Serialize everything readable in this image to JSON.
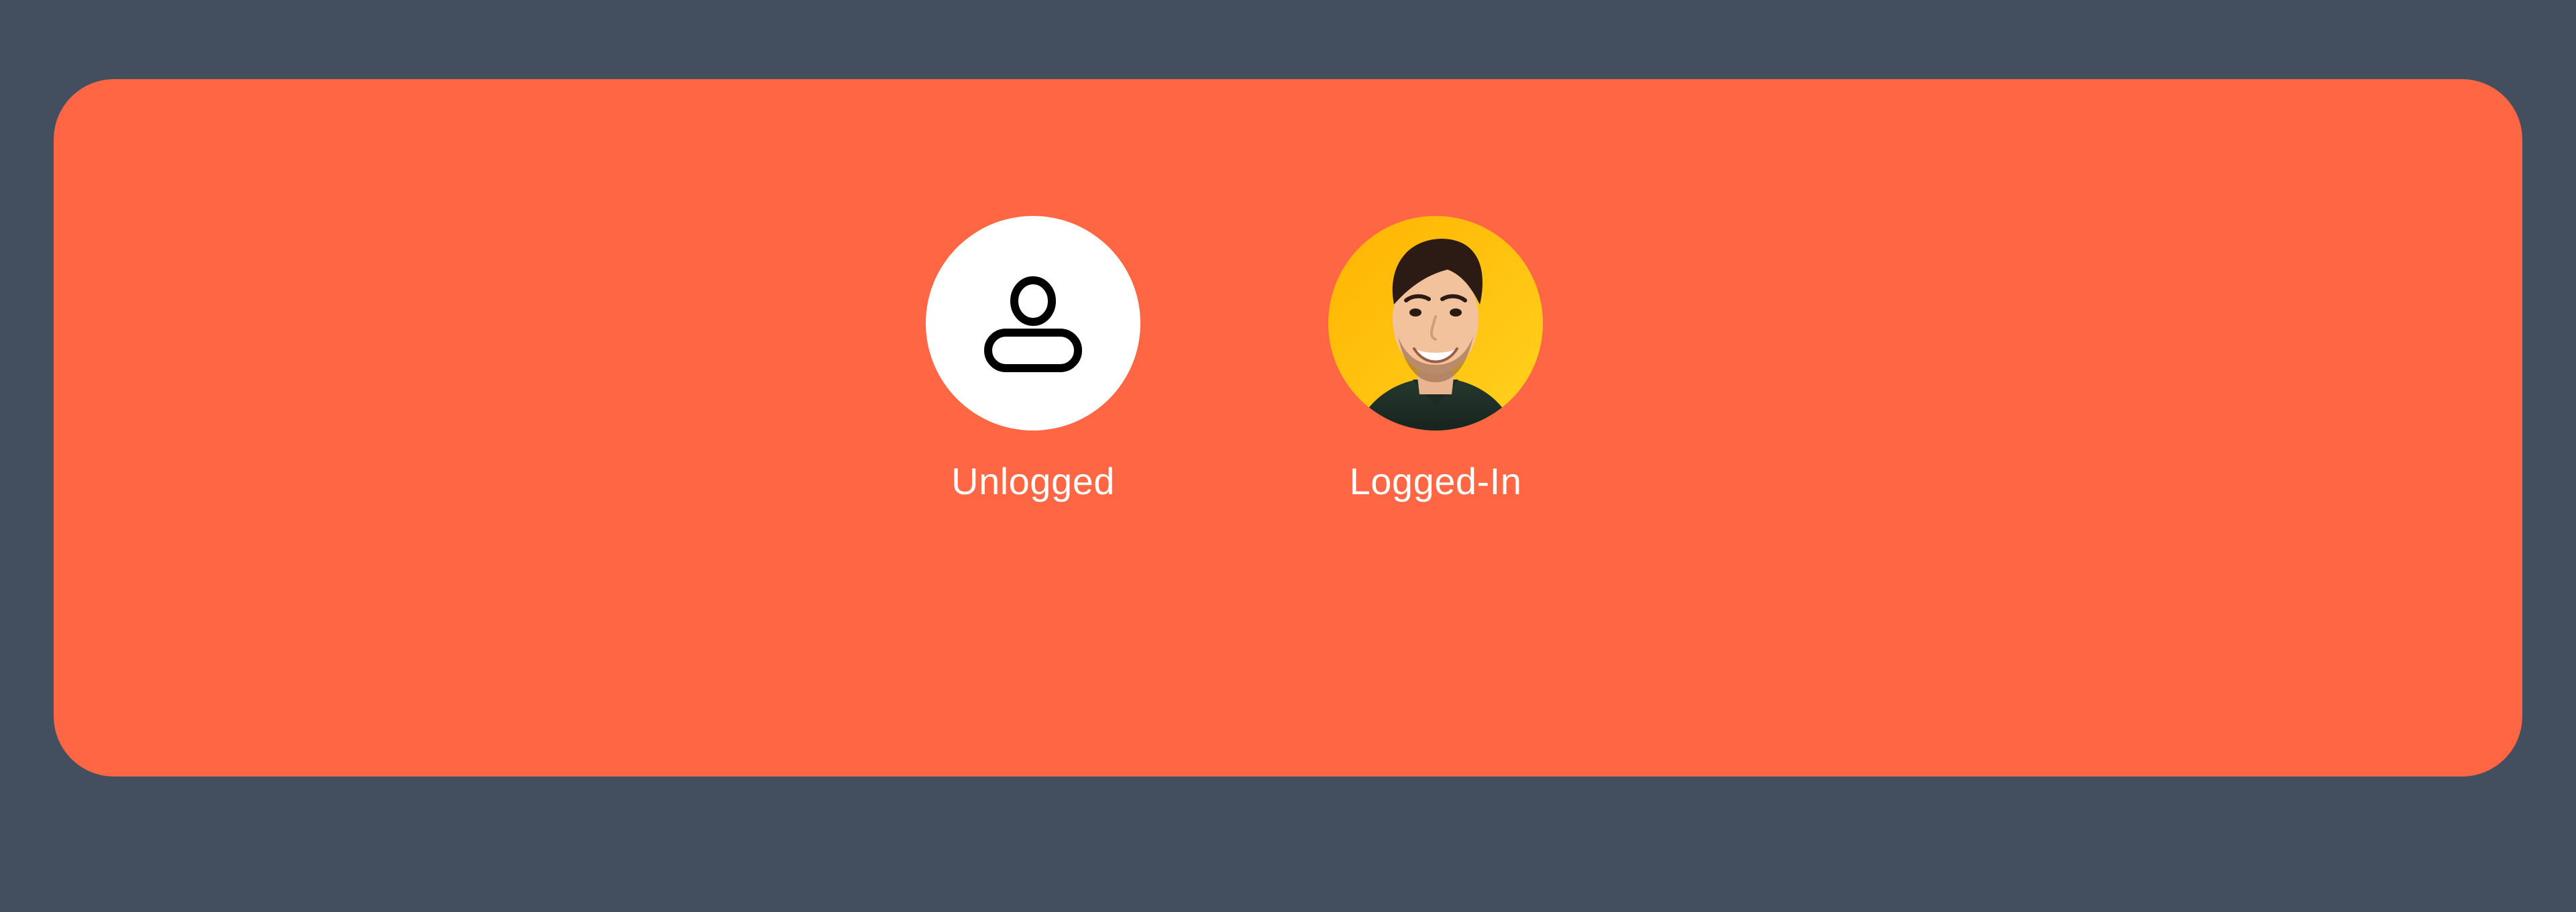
{
  "colors": {
    "page_background": "#434f5f",
    "card_background": "#ff6644",
    "text": "#ffffff",
    "unlogged_avatar_background": "#ffffff",
    "photo_background": "#ffc400"
  },
  "states": [
    {
      "label": "Unlogged",
      "icon": "user-icon"
    },
    {
      "label": "Logged-In",
      "icon": "user-photo"
    }
  ]
}
